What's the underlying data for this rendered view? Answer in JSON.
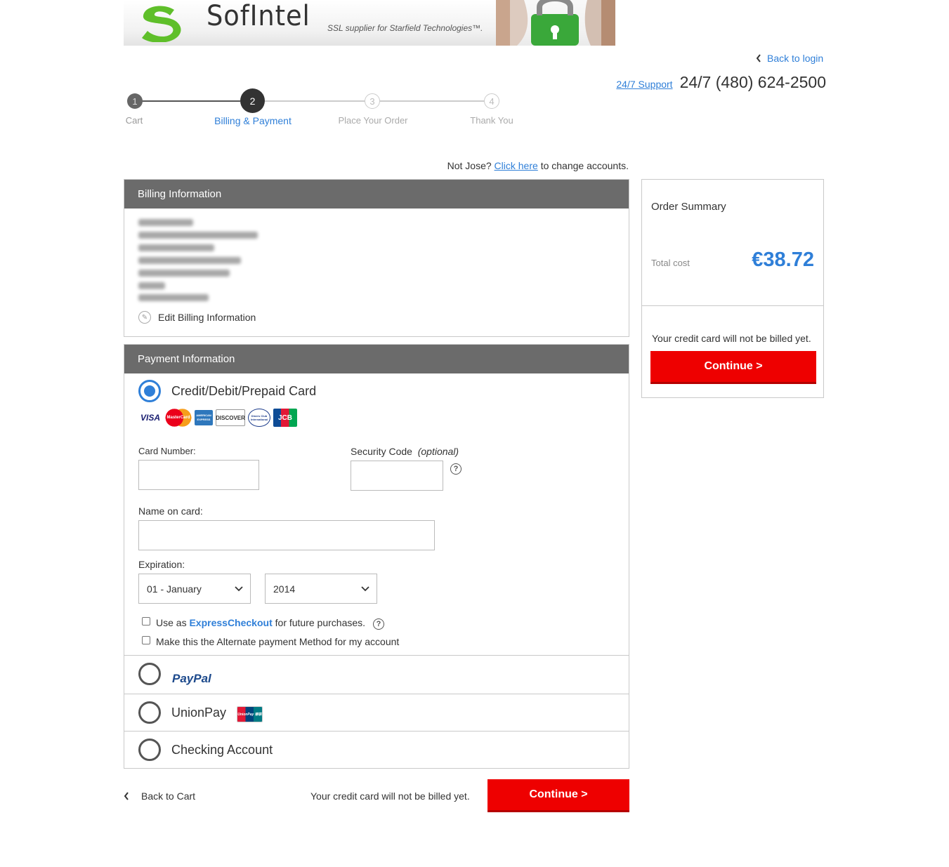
{
  "banner": {
    "brand": "SofIntel",
    "tagline": "SSL supplier for Starfield Technologies™."
  },
  "header": {
    "back_to_login": "Back to login",
    "support_link": "24/7 Support",
    "phone": "24/7 (480) 624-2500"
  },
  "stepper": {
    "steps": [
      {
        "number": "1",
        "label": "Cart"
      },
      {
        "number": "2",
        "label": "Billing & Payment"
      },
      {
        "number": "3",
        "label": "Place Your Order"
      },
      {
        "number": "4",
        "label": "Thank You"
      }
    ],
    "active_step": 2
  },
  "account": {
    "prefix": "Not Jose?",
    "link": "Click here",
    "suffix": "to change accounts."
  },
  "billing": {
    "header": "Billing Information",
    "edit_label": "Edit Billing Information"
  },
  "payment": {
    "header": "Payment Information",
    "options": {
      "card": "Credit/Debit/Prepaid Card",
      "paypal": "PayPal",
      "unionpay": "UnionPay",
      "checking": "Checking Account"
    },
    "selected_option": "card",
    "card_logos": [
      "VISA",
      "MasterCard",
      "AMERICAN EXPRESS",
      "DISCOVER",
      "Diners Club International",
      "JCB"
    ],
    "card_number_label": "Card Number:",
    "card_number_value": "",
    "security_code_label": "Security Code",
    "security_code_optional": "(optional)",
    "security_code_value": "",
    "name_on_card_label": "Name on card:",
    "name_on_card_value": "",
    "expiration_label": "Expiration:",
    "expiration_month": "01 - January",
    "expiration_year": "2014",
    "express_prefix": "Use as",
    "express_brand": "ExpressCheckout",
    "express_suffix": "for future purchases.",
    "alternate_label": "Make this the Alternate payment Method for my account",
    "unionpay_logo_text": "UnionPay 银联"
  },
  "summary": {
    "title": "Order Summary",
    "total_label": "Total cost",
    "total_value": "€38.72",
    "not_billed": "Your credit card will not be billed yet.",
    "continue": "Continue >"
  },
  "footer": {
    "back_to_cart": "Back to Cart",
    "not_billed": "Your credit card will not be billed yet.",
    "continue": "Continue >"
  },
  "colors": {
    "accent": "#2f7fd8",
    "button": "#ee0000",
    "panel_header": "#6b6b6b"
  }
}
